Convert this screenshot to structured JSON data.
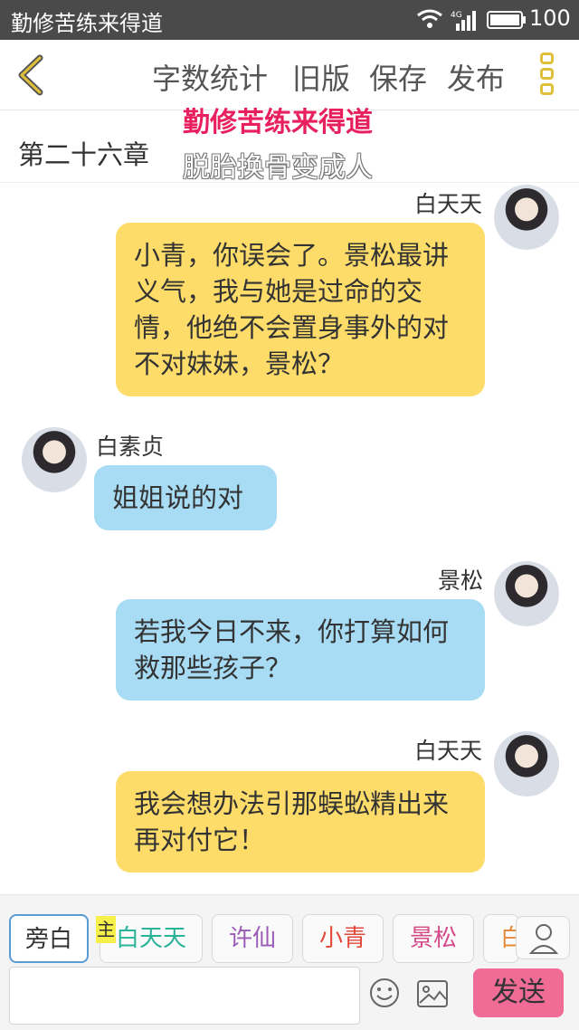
{
  "status_bar": {
    "app_title": "勤修苦练来得道",
    "signal_label": "4G",
    "battery": "100"
  },
  "toolbar": {
    "word_count": "字数统计",
    "old_version": "旧版",
    "save": "保存",
    "publish": "发布"
  },
  "chapter": {
    "title": "第二十六章"
  },
  "watermark": {
    "line1": "勤修苦练来得道",
    "line2": "脱胎换骨变成人"
  },
  "messages": [
    {
      "speaker": "白天天",
      "side": "right",
      "color": "yellow",
      "text": "小青，你误会了。景松最讲义气，我与她是过命的交情，他绝不会置身事外的对不对妹妹，景松？"
    },
    {
      "speaker": "白素贞",
      "side": "left",
      "color": "blue",
      "text": "姐姐说的对"
    },
    {
      "speaker": "景松",
      "side": "right",
      "color": "blue",
      "text": "若我今日不来，你打算如何救那些孩子？"
    },
    {
      "speaker": "白天天",
      "side": "right",
      "color": "yellow",
      "text": "我会想办法引那蜈蚣精出来再对付它！"
    }
  ],
  "characters": [
    {
      "label": "旁白",
      "color": "#333333"
    },
    {
      "label": "白天天",
      "color": "#2bb39a"
    },
    {
      "label": "许仙",
      "color": "#9b59b6"
    },
    {
      "label": "小青",
      "color": "#e2493b"
    },
    {
      "label": "景松",
      "color": "#d44b8a"
    },
    {
      "label": "白",
      "color": "#e58a3a"
    }
  ],
  "main_badge": "主",
  "composer": {
    "placeholder": "",
    "send": "发送"
  }
}
